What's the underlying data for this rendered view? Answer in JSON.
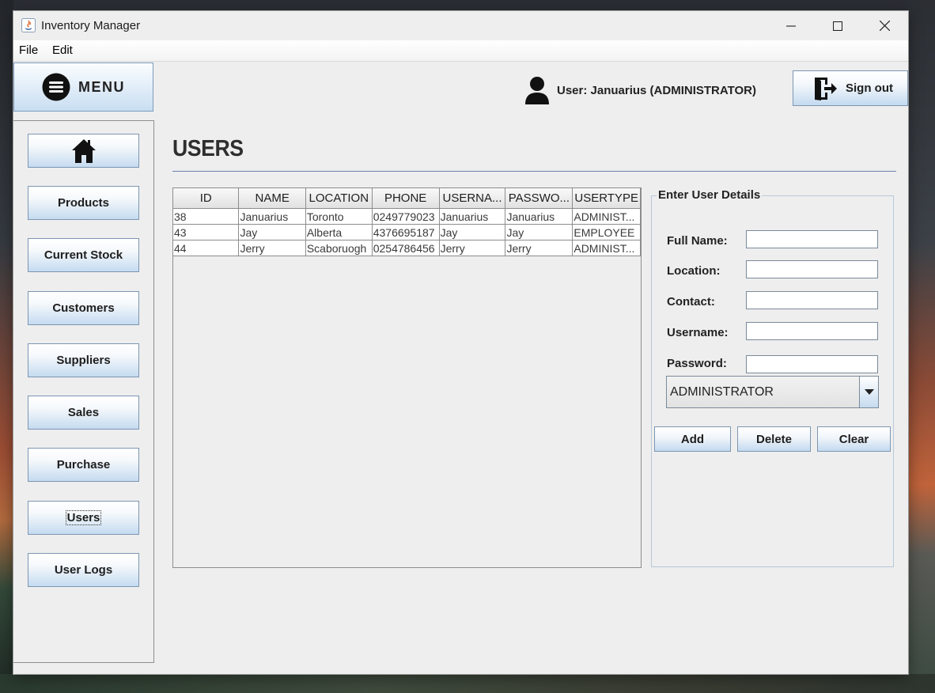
{
  "window": {
    "title": "Inventory Manager"
  },
  "menubar": {
    "items": [
      "File",
      "Edit"
    ]
  },
  "sidebar": {
    "menu_label": "MENU",
    "items": [
      {
        "label": ""
      },
      {
        "label": "Products"
      },
      {
        "label": "Current Stock"
      },
      {
        "label": "Customers"
      },
      {
        "label": "Suppliers"
      },
      {
        "label": "Sales"
      },
      {
        "label": "Purchase"
      },
      {
        "label": "Users"
      },
      {
        "label": "User Logs"
      }
    ]
  },
  "header": {
    "user_text": "User: Januarius (ADMINISTRATOR)",
    "signout_label": "Sign out"
  },
  "main": {
    "title": "USERS",
    "table": {
      "columns": [
        "ID",
        "NAME",
        "LOCATION",
        "PHONE",
        "USERNA...",
        "PASSWO...",
        "USERTYPE"
      ],
      "rows": [
        [
          "38",
          "Januarius",
          "Toronto",
          "0249779023",
          "Januarius",
          "Januarius",
          "ADMINIST..."
        ],
        [
          "43",
          "Jay",
          "Alberta",
          "4376695187",
          "Jay",
          "Jay",
          "EMPLOYEE"
        ],
        [
          "44",
          "Jerry",
          "Scaboruogh",
          "0254786456",
          "Jerry",
          "Jerry",
          "ADMINIST..."
        ]
      ]
    }
  },
  "details": {
    "legend": "Enter User Details",
    "fields": [
      {
        "label": "Full Name:",
        "value": ""
      },
      {
        "label": "Location:",
        "value": ""
      },
      {
        "label": "Contact:",
        "value": ""
      },
      {
        "label": "Username:",
        "value": ""
      },
      {
        "label": "Password:",
        "value": ""
      }
    ],
    "usertype_selected": "ADMINISTRATOR",
    "buttons": {
      "add": "Add",
      "delete": "Delete",
      "clear": "Clear"
    }
  },
  "colors": {
    "button_gradient_top": "#ffffff",
    "button_gradient_bottom": "#c4daf0",
    "rule": "#6d7fae"
  }
}
